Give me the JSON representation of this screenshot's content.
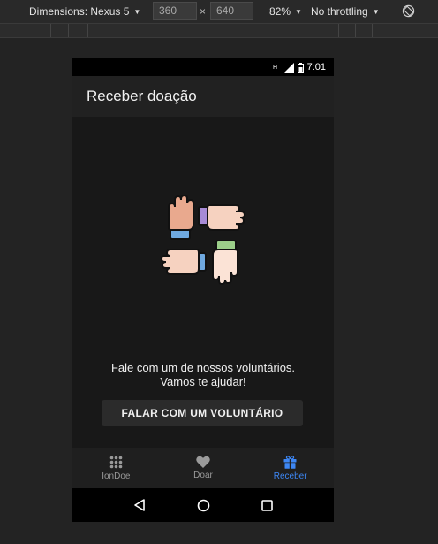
{
  "devtools": {
    "dimensions_label": "Dimensions: Nexus 5",
    "width_value": "360",
    "height_value": "640",
    "separator": "×",
    "zoom_label": "82%",
    "throttling_label": "No throttling"
  },
  "status_bar": {
    "time": "7:01"
  },
  "app_bar": {
    "title": "Receber doação"
  },
  "main": {
    "message_line1": "Fale com um de nossos voluntários.",
    "message_line2": "Vamos te ajudar!",
    "cta_label": "FALAR COM UM VOLUNTÁRIO"
  },
  "tabs": [
    {
      "label": "IonDoe",
      "icon": "apps-grid-icon",
      "active": false
    },
    {
      "label": "Doar",
      "icon": "heart-icon",
      "active": false
    },
    {
      "label": "Receber",
      "icon": "gift-icon",
      "active": true
    }
  ],
  "colors": {
    "accent": "#3d87f5",
    "background": "#181818"
  }
}
